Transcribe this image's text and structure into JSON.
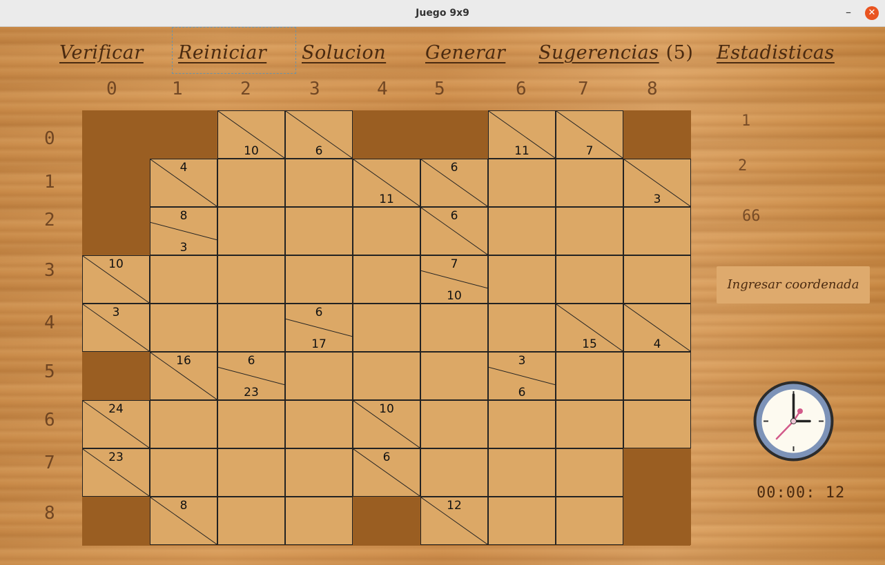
{
  "window": {
    "title": "Juego 9x9",
    "minimize_label": "–",
    "close_label": "✕"
  },
  "menu": {
    "verify": "Verificar",
    "restart": "Reiniciar",
    "solution": "Solucion",
    "generate": "Generar",
    "hints": "Sugerencias",
    "hints_count": "(5)",
    "stats": "Estadisticas"
  },
  "columns": [
    "0",
    "1",
    "2",
    "3",
    "4",
    "5",
    "6",
    "7",
    "8"
  ],
  "rows": [
    "0",
    "1",
    "2",
    "3",
    "4",
    "5",
    "6",
    "7",
    "8"
  ],
  "grid": [
    [
      {
        "t": "black"
      },
      {
        "t": "black"
      },
      {
        "t": "clue",
        "d": "10"
      },
      {
        "t": "clue",
        "d": "6"
      },
      {
        "t": "black"
      },
      {
        "t": "black"
      },
      {
        "t": "clue",
        "d": "11"
      },
      {
        "t": "clue",
        "d": "7"
      },
      {
        "t": "black"
      }
    ],
    [
      {
        "t": "black"
      },
      {
        "t": "clue",
        "r": "4"
      },
      {
        "t": "empty"
      },
      {
        "t": "empty"
      },
      {
        "t": "clue",
        "d": "11"
      },
      {
        "t": "clue",
        "r": "6"
      },
      {
        "t": "empty"
      },
      {
        "t": "empty"
      },
      {
        "t": "clue",
        "d": "3"
      }
    ],
    [
      {
        "t": "black"
      },
      {
        "t": "clue",
        "r": "8",
        "d": "3"
      },
      {
        "t": "empty"
      },
      {
        "t": "empty"
      },
      {
        "t": "empty"
      },
      {
        "t": "clue",
        "r": "6"
      },
      {
        "t": "empty"
      },
      {
        "t": "empty"
      },
      {
        "t": "empty"
      }
    ],
    [
      {
        "t": "clue",
        "r": "10"
      },
      {
        "t": "empty"
      },
      {
        "t": "empty"
      },
      {
        "t": "empty"
      },
      {
        "t": "empty"
      },
      {
        "t": "clue",
        "r": "7",
        "d": "10"
      },
      {
        "t": "empty"
      },
      {
        "t": "empty"
      },
      {
        "t": "empty"
      }
    ],
    [
      {
        "t": "clue",
        "r": "3"
      },
      {
        "t": "empty"
      },
      {
        "t": "empty"
      },
      {
        "t": "clue",
        "r": "6",
        "d": "17"
      },
      {
        "t": "empty"
      },
      {
        "t": "empty"
      },
      {
        "t": "empty"
      },
      {
        "t": "clue",
        "d": "15"
      },
      {
        "t": "clue",
        "d": "4"
      }
    ],
    [
      {
        "t": "black"
      },
      {
        "t": "clue",
        "r": "16"
      },
      {
        "t": "clue",
        "r": "6",
        "d": "23"
      },
      {
        "t": "empty"
      },
      {
        "t": "empty"
      },
      {
        "t": "empty"
      },
      {
        "t": "clue",
        "r": "3",
        "d": "6"
      },
      {
        "t": "empty"
      },
      {
        "t": "empty"
      }
    ],
    [
      {
        "t": "clue",
        "r": "24"
      },
      {
        "t": "empty"
      },
      {
        "t": "empty"
      },
      {
        "t": "empty"
      },
      {
        "t": "clue",
        "r": "10"
      },
      {
        "t": "empty"
      },
      {
        "t": "empty"
      },
      {
        "t": "empty"
      },
      {
        "t": "empty"
      }
    ],
    [
      {
        "t": "clue",
        "r": "23"
      },
      {
        "t": "empty"
      },
      {
        "t": "empty"
      },
      {
        "t": "empty"
      },
      {
        "t": "clue",
        "r": "6"
      },
      {
        "t": "empty"
      },
      {
        "t": "empty"
      },
      {
        "t": "empty"
      },
      {
        "t": "black"
      }
    ],
    [
      {
        "t": "black"
      },
      {
        "t": "clue",
        "r": "8"
      },
      {
        "t": "empty"
      },
      {
        "t": "empty"
      },
      {
        "t": "black"
      },
      {
        "t": "clue",
        "r": "12"
      },
      {
        "t": "empty"
      },
      {
        "t": "empty"
      },
      {
        "t": "black"
      }
    ]
  ],
  "side_values": [
    "1",
    "2",
    "66"
  ],
  "coord_button": "Ingresar coordenada",
  "clock_icon": "analog-clock-icon",
  "timer": "00:00: 12"
}
